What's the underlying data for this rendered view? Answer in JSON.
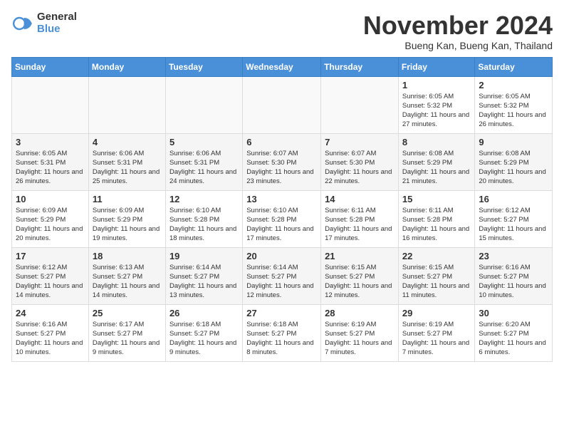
{
  "header": {
    "logo_general": "General",
    "logo_blue": "Blue",
    "month_title": "November 2024",
    "location": "Bueng Kan, Bueng Kan, Thailand"
  },
  "weekdays": [
    "Sunday",
    "Monday",
    "Tuesday",
    "Wednesday",
    "Thursday",
    "Friday",
    "Saturday"
  ],
  "weeks": [
    [
      {
        "day": "",
        "info": ""
      },
      {
        "day": "",
        "info": ""
      },
      {
        "day": "",
        "info": ""
      },
      {
        "day": "",
        "info": ""
      },
      {
        "day": "",
        "info": ""
      },
      {
        "day": "1",
        "info": "Sunrise: 6:05 AM\nSunset: 5:32 PM\nDaylight: 11 hours and 27 minutes."
      },
      {
        "day": "2",
        "info": "Sunrise: 6:05 AM\nSunset: 5:32 PM\nDaylight: 11 hours and 26 minutes."
      }
    ],
    [
      {
        "day": "3",
        "info": "Sunrise: 6:05 AM\nSunset: 5:31 PM\nDaylight: 11 hours and 26 minutes."
      },
      {
        "day": "4",
        "info": "Sunrise: 6:06 AM\nSunset: 5:31 PM\nDaylight: 11 hours and 25 minutes."
      },
      {
        "day": "5",
        "info": "Sunrise: 6:06 AM\nSunset: 5:31 PM\nDaylight: 11 hours and 24 minutes."
      },
      {
        "day": "6",
        "info": "Sunrise: 6:07 AM\nSunset: 5:30 PM\nDaylight: 11 hours and 23 minutes."
      },
      {
        "day": "7",
        "info": "Sunrise: 6:07 AM\nSunset: 5:30 PM\nDaylight: 11 hours and 22 minutes."
      },
      {
        "day": "8",
        "info": "Sunrise: 6:08 AM\nSunset: 5:29 PM\nDaylight: 11 hours and 21 minutes."
      },
      {
        "day": "9",
        "info": "Sunrise: 6:08 AM\nSunset: 5:29 PM\nDaylight: 11 hours and 20 minutes."
      }
    ],
    [
      {
        "day": "10",
        "info": "Sunrise: 6:09 AM\nSunset: 5:29 PM\nDaylight: 11 hours and 20 minutes."
      },
      {
        "day": "11",
        "info": "Sunrise: 6:09 AM\nSunset: 5:29 PM\nDaylight: 11 hours and 19 minutes."
      },
      {
        "day": "12",
        "info": "Sunrise: 6:10 AM\nSunset: 5:28 PM\nDaylight: 11 hours and 18 minutes."
      },
      {
        "day": "13",
        "info": "Sunrise: 6:10 AM\nSunset: 5:28 PM\nDaylight: 11 hours and 17 minutes."
      },
      {
        "day": "14",
        "info": "Sunrise: 6:11 AM\nSunset: 5:28 PM\nDaylight: 11 hours and 17 minutes."
      },
      {
        "day": "15",
        "info": "Sunrise: 6:11 AM\nSunset: 5:28 PM\nDaylight: 11 hours and 16 minutes."
      },
      {
        "day": "16",
        "info": "Sunrise: 6:12 AM\nSunset: 5:27 PM\nDaylight: 11 hours and 15 minutes."
      }
    ],
    [
      {
        "day": "17",
        "info": "Sunrise: 6:12 AM\nSunset: 5:27 PM\nDaylight: 11 hours and 14 minutes."
      },
      {
        "day": "18",
        "info": "Sunrise: 6:13 AM\nSunset: 5:27 PM\nDaylight: 11 hours and 14 minutes."
      },
      {
        "day": "19",
        "info": "Sunrise: 6:14 AM\nSunset: 5:27 PM\nDaylight: 11 hours and 13 minutes."
      },
      {
        "day": "20",
        "info": "Sunrise: 6:14 AM\nSunset: 5:27 PM\nDaylight: 11 hours and 12 minutes."
      },
      {
        "day": "21",
        "info": "Sunrise: 6:15 AM\nSunset: 5:27 PM\nDaylight: 11 hours and 12 minutes."
      },
      {
        "day": "22",
        "info": "Sunrise: 6:15 AM\nSunset: 5:27 PM\nDaylight: 11 hours and 11 minutes."
      },
      {
        "day": "23",
        "info": "Sunrise: 6:16 AM\nSunset: 5:27 PM\nDaylight: 11 hours and 10 minutes."
      }
    ],
    [
      {
        "day": "24",
        "info": "Sunrise: 6:16 AM\nSunset: 5:27 PM\nDaylight: 11 hours and 10 minutes."
      },
      {
        "day": "25",
        "info": "Sunrise: 6:17 AM\nSunset: 5:27 PM\nDaylight: 11 hours and 9 minutes."
      },
      {
        "day": "26",
        "info": "Sunrise: 6:18 AM\nSunset: 5:27 PM\nDaylight: 11 hours and 9 minutes."
      },
      {
        "day": "27",
        "info": "Sunrise: 6:18 AM\nSunset: 5:27 PM\nDaylight: 11 hours and 8 minutes."
      },
      {
        "day": "28",
        "info": "Sunrise: 6:19 AM\nSunset: 5:27 PM\nDaylight: 11 hours and 7 minutes."
      },
      {
        "day": "29",
        "info": "Sunrise: 6:19 AM\nSunset: 5:27 PM\nDaylight: 11 hours and 7 minutes."
      },
      {
        "day": "30",
        "info": "Sunrise: 6:20 AM\nSunset: 5:27 PM\nDaylight: 11 hours and 6 minutes."
      }
    ]
  ]
}
